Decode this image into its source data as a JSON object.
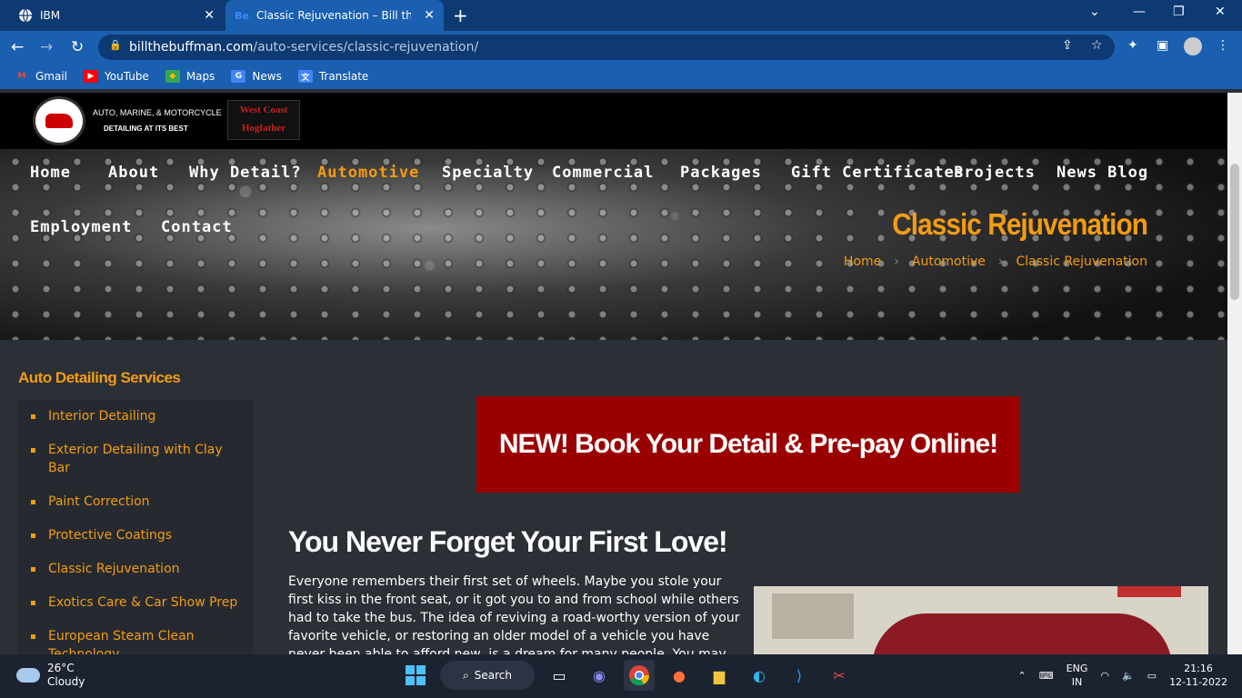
{
  "browser": {
    "tabs": [
      {
        "title": "IBM",
        "favicon": "globe-icon",
        "active": false
      },
      {
        "title": "Classic Rejuvenation – Bill the Buffman",
        "favicon": "behance-icon",
        "active": true
      }
    ],
    "url_host": "billthebuffman.com",
    "url_path": "/auto-services/classic-rejuvenation/",
    "bookmarks": [
      "Gmail",
      "YouTube",
      "Maps",
      "News",
      "Translate"
    ]
  },
  "site": {
    "logo_line1": "AUTO, MARINE, & MOTORCYCLE",
    "logo_line2": "DETAILING AT ITS BEST",
    "partner_logo_top": "West Coast",
    "partner_logo_bottom": "Hogfather",
    "menu": [
      "Home",
      "About",
      "Why Detail?",
      "Automotive",
      "Specialty",
      "Commercial",
      "Packages",
      "Gift Certificates",
      "Projects",
      "News Blog",
      "Employment",
      "Contact"
    ],
    "active_menu": "Automotive",
    "page_title": "Classic Rejuvenation",
    "breadcrumb": [
      "Home",
      "Automotive",
      "Classic Rejuvenation"
    ],
    "breadcrumb_sep": "›"
  },
  "sidebar": {
    "heading": "Auto Detailing Services",
    "items": [
      "Interior Detailing",
      "Exterior Detailing with Clay Bar",
      "Paint Correction",
      "Protective Coatings",
      "Classic Rejuvenation",
      "Exotics Care & Car Show Prep",
      "European Steam Clean Technology"
    ]
  },
  "main": {
    "cta": "NEW! Book Your Detail & Pre-pay Online!",
    "heading": "You Never Forget Your First Love!",
    "paragraph": "Everyone remembers their first set of wheels. Maybe you stole your first kiss in the front seat, or it got you to and from school while others had to take the bus. The idea of reviving a road-worthy version of your favorite vehicle, or restoring an older model of a vehicle you have never been able to afford new, is a dream for many people. You may even have an aging and"
  },
  "taskbar": {
    "temp": "26°C",
    "condition": "Cloudy",
    "search": "Search",
    "lang1": "ENG",
    "lang2": "IN",
    "time": "21:16",
    "date": "12-11-2022"
  }
}
